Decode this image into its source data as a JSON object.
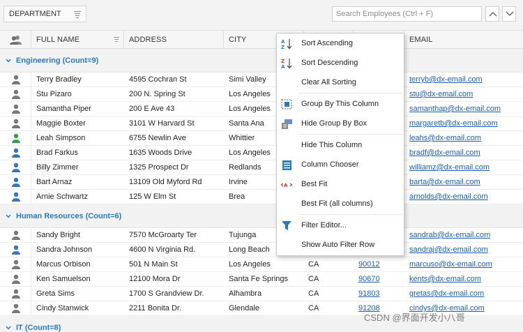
{
  "group_panel": {
    "group_column": "DEPARTMENT",
    "search_placeholder": "Search Employees (Ctrl + F)"
  },
  "columns": {
    "full_name": "FULL NAME",
    "address": "ADDRESS",
    "city": "CITY",
    "email": "EMAIL"
  },
  "groups": [
    {
      "label": "Engineering (Count=9)",
      "rows": [
        {
          "name": "Terry Bradley",
          "address": "4595 Cochran St",
          "city": "Simi Valley",
          "state": "",
          "zip": "",
          "email": "terryb@dx-email.com",
          "icon": "gray"
        },
        {
          "name": "Stu Pizaro",
          "address": "200 N. Spring St",
          "city": "Los Angeles",
          "state": "",
          "zip": "",
          "email": "stu@dx-email.com",
          "icon": "gray"
        },
        {
          "name": "Samantha Piper",
          "address": "200 E Ave 43",
          "city": "Los Angeles",
          "state": "",
          "zip": "",
          "email": "samanthap@dx-email.com",
          "icon": "gray"
        },
        {
          "name": "Maggie Boxter",
          "address": "3101 W Harvard St",
          "city": "Santa Ana",
          "state": "",
          "zip": "",
          "email": "margaretb@dx-email.com",
          "icon": "gray"
        },
        {
          "name": "Leah Simpson",
          "address": "6755 Newlin Ave",
          "city": "Whittier",
          "state": "",
          "zip": "",
          "email": "leahs@dx-email.com",
          "icon": "green"
        },
        {
          "name": "Brad Farkus",
          "address": "1635 Woods Drive",
          "city": "Los Angeles",
          "state": "",
          "zip": "",
          "email": "bradf@dx-email.com",
          "icon": "blue"
        },
        {
          "name": "Billy Zimmer",
          "address": "1325 Prospect Dr",
          "city": "Redlands",
          "state": "",
          "zip": "",
          "email": "williamz@dx-email.com",
          "icon": "blue"
        },
        {
          "name": "Bart Arnaz",
          "address": "13109 Old Myford Rd",
          "city": "Irvine",
          "state": "",
          "zip": "",
          "email": "barta@dx-email.com",
          "icon": "blue"
        },
        {
          "name": "Arnie Schwartz",
          "address": "125 W Elm St",
          "city": "Brea",
          "state": "",
          "zip": "",
          "email": "arnolds@dx-email.com",
          "icon": "blue"
        }
      ]
    },
    {
      "label": "Human Resources (Count=6)",
      "rows": [
        {
          "name": "Sandy Bright",
          "address": "7570 McGroarty Ter",
          "city": "Tujunga",
          "state": "",
          "zip": "",
          "email": "sandrab@dx-email.com",
          "icon": "gray"
        },
        {
          "name": "Sandra Johnson",
          "address": "4600 N Virginia Rd.",
          "city": "Long Beach",
          "state": "",
          "zip": "",
          "email": "sandraj@dx-email.com",
          "icon": "blue"
        },
        {
          "name": "Marcus Orbison",
          "address": "501 N Main St",
          "city": "Los Angeles",
          "state": "CA",
          "zip": "90012",
          "email": "marcuso@dx-email.com",
          "icon": "gray"
        },
        {
          "name": "Ken Samuelson",
          "address": "12100 Mora Dr",
          "city": "Santa Fe Springs",
          "state": "CA",
          "zip": "90670",
          "email": "kents@dx-email.com",
          "icon": "gray"
        },
        {
          "name": "Greta Sims",
          "address": "1700 S Grandview Dr.",
          "city": "Alhambra",
          "state": "CA",
          "zip": "91803",
          "email": "gretas@dx-email.com",
          "icon": "gray"
        },
        {
          "name": "Cindy Stanwick",
          "address": "2211 Bonita Dr.",
          "city": "Glendale",
          "state": "CA",
          "zip": "91208",
          "email": "cindys@dx-email.com",
          "icon": "gray"
        }
      ]
    },
    {
      "label": "IT (Count=8)",
      "rows": []
    }
  ],
  "context_menu": [
    {
      "label": "Sort Ascending",
      "icon": "sort-ascending-icon"
    },
    {
      "label": "Sort Descending",
      "icon": "sort-descending-icon"
    },
    {
      "label": "Clear All Sorting",
      "icon": ""
    },
    {
      "label": "Group By This Column",
      "icon": "group-by-column-icon"
    },
    {
      "label": "Hide Group By Box",
      "icon": "hide-group-box-icon"
    },
    {
      "label": "Hide This Column",
      "icon": ""
    },
    {
      "label": "Column Chooser",
      "icon": "column-chooser-icon"
    },
    {
      "label": "Best Fit",
      "icon": "best-fit-icon"
    },
    {
      "label": "Best Fit (all columns)",
      "icon": ""
    },
    {
      "label": "Filter Editor...",
      "icon": "filter-editor-icon"
    },
    {
      "label": "Show Auto Filter Row",
      "icon": ""
    }
  ],
  "watermark": "CSDN @界面开发小八哥",
  "colors": {
    "accent": "#2b79c2",
    "link": "#1a5fb4",
    "icon_gray": "#777777",
    "icon_green": "#3a9a4a",
    "icon_blue": "#3b72b8"
  }
}
